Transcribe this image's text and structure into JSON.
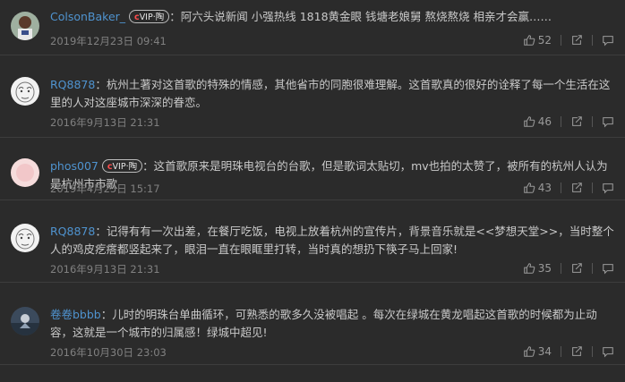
{
  "comments": [
    {
      "user": "ColsonBaker_",
      "vip": true,
      "vip_label": "·陶",
      "vip_badge_prefix": "VIP",
      "text": "阿六头说新闻 小强热线 1818黄金眼 钱塘老娘舅 熬烧熬烧 相亲才会赢……",
      "time": "2019年12月23日 09:41",
      "likes": "52"
    },
    {
      "user": "RQ8878",
      "vip": false,
      "text": "杭州土著对这首歌的特殊的情感，其他省市的同胞很难理解。这首歌真的很好的诠释了每一个生活在这里的人对这座城市深深的眷恋。",
      "time": "2016年9月13日 21:31",
      "likes": "46"
    },
    {
      "user": "phos007",
      "vip": true,
      "vip_label": "·陶",
      "vip_badge_prefix": "VIP",
      "text": "这首歌原来是明珠电视台的台歌，但是歌词太贴切，mv也拍的太赞了，被所有的杭州人认为是杭州市市歌",
      "time": "2019年4月25日 15:17",
      "likes": "43"
    },
    {
      "user": "RQ8878",
      "vip": false,
      "text": "记得有有一次出差，在餐厅吃饭，电视上放着杭州的宣传片，背景音乐就是<<梦想天堂>>，当时整个人的鸡皮疙瘩都竖起来了，眼泪一直在眼眶里打转，当时真的想扔下筷子马上回家!",
      "time": "2016年9月13日 21:31",
      "likes": "35"
    },
    {
      "user": "卷卷bbbb",
      "vip": false,
      "text": "儿时的明珠台单曲循环，可熟悉的歌多久没被唱起 。每次在绿城在黄龙唱起这首歌的时候都为止动容，这就是一个城市的归属感！绿城中超见!",
      "time": "2016年10月30日 23:03",
      "likes": "34"
    }
  ],
  "colors": {
    "background": "#2b2b2b",
    "username": "#4f93cf",
    "text": "#c9c9c9",
    "meta": "#808080"
  },
  "icons": {
    "like": "thumbs-up-icon",
    "share": "share-icon",
    "comment": "reply-icon"
  }
}
